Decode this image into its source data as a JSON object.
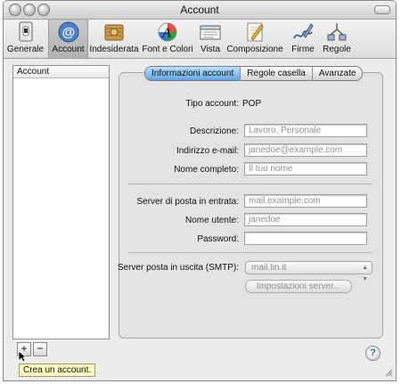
{
  "window": {
    "title": "Account"
  },
  "toolbar": {
    "items": [
      {
        "label": "Generale",
        "icon": "switch-icon"
      },
      {
        "label": "Account",
        "icon": "at-icon"
      },
      {
        "label": "Indesiderata",
        "icon": "junk-mail-icon"
      },
      {
        "label": "Font e Colori",
        "icon": "font-colors-icon"
      },
      {
        "label": "Vista",
        "icon": "view-icon"
      },
      {
        "label": "Composizione",
        "icon": "compose-icon"
      },
      {
        "label": "Firme",
        "icon": "signature-icon"
      },
      {
        "label": "Regole",
        "icon": "rules-icon"
      }
    ],
    "selected": "Account"
  },
  "sidebar": {
    "header": "Account"
  },
  "list_buttons": {
    "add": "+",
    "remove": "−"
  },
  "tooltip": "Crea un account.",
  "tabs": [
    {
      "label": "Informazioni account",
      "active": true
    },
    {
      "label": "Regole casella",
      "active": false
    },
    {
      "label": "Avanzate",
      "active": false
    }
  ],
  "form": {
    "account_type_label": "Tipo account:",
    "account_type_value": "POP",
    "description_label": "Descrizione:",
    "description_placeholder": "Lavoro, Personale",
    "email_label": "Indirizzo e-mail:",
    "email_placeholder": "janedoe@example.com",
    "fullname_label": "Nome completo:",
    "fullname_placeholder": "Il tuo nome",
    "incoming_server_label": "Server di posta in entrata:",
    "incoming_server_placeholder": "mail.example.com",
    "username_label": "Nome utente:",
    "username_placeholder": "janedoe",
    "password_label": "Password:",
    "password_value": "",
    "smtp_label": "Server posta in uscita (SMTP):",
    "smtp_value": "mail.tin.it",
    "server_settings_button": "Impostazioni server..."
  },
  "help": "?",
  "colors": {
    "selected_tab": "#5ea6e8",
    "tooltip_bg": "#fffdc0",
    "help_glyph": "#3b63a8"
  }
}
